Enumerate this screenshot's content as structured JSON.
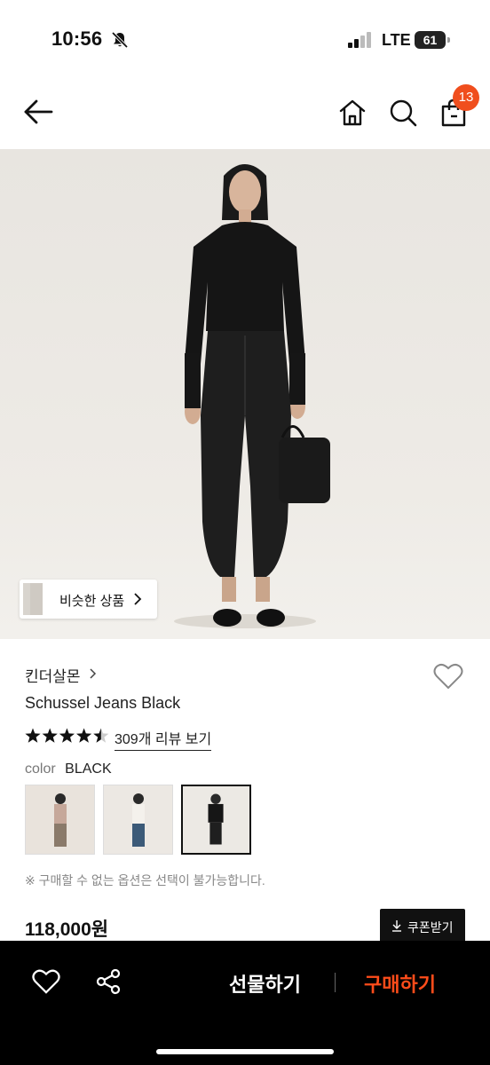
{
  "status": {
    "time": "10:56",
    "network": "LTE",
    "battery": "61"
  },
  "nav": {
    "cart_count": "13"
  },
  "image": {
    "similar_label": "비슷한 상품"
  },
  "product": {
    "brand": "킨더살몬",
    "name": "Schussel Jeans Black",
    "rating": 4.5,
    "review_link": "309개 리뷰 보기",
    "color_label": "color",
    "color_value": "BLACK",
    "notice": "※ 구매할 수 없는 옵션은 선택이 불가능합니다.",
    "price": "118,000원",
    "coupon_label": "쿠폰받기"
  },
  "bottom": {
    "gift_label": "선물하기",
    "buy_label": "구매하기"
  },
  "colors": {
    "accent": "#f04e1d",
    "buy": "#ff4c1a"
  }
}
